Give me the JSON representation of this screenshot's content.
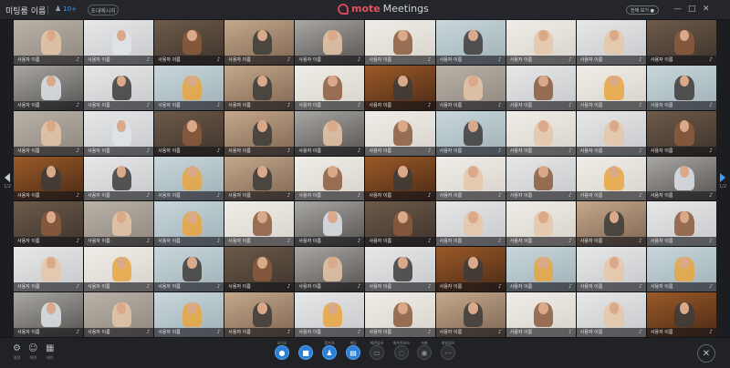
{
  "window": {
    "meeting_name": "미팅룸 이름",
    "participants_icon": "people-icon",
    "participant_count": "10+",
    "invite_label": "초대메시지",
    "logo_mote": "mote",
    "logo_meetings": "Meetings",
    "all_view_label": "전체 보기 ●",
    "minimize": "—",
    "maximize": "□",
    "close": "✕"
  },
  "grid": {
    "tile_name": "사용자 이름",
    "mic_icon": "mic-icon",
    "tiles": [
      {
        "bg": "bg-1",
        "p": "p-a"
      },
      {
        "bg": "bg-2",
        "p": "p-e"
      },
      {
        "bg": "bg-3",
        "p": "p-d"
      },
      {
        "bg": "bg-4",
        "p": "p-b"
      },
      {
        "bg": "bg-5",
        "p": "p-a"
      },
      {
        "bg": "bg-8",
        "p": "p-d"
      },
      {
        "bg": "bg-6",
        "p": "p-b"
      },
      {
        "bg": "bg-8",
        "p": "p-a"
      },
      {
        "bg": "bg-2",
        "p": "p-a"
      },
      {
        "bg": "bg-3",
        "p": "p-d"
      },
      {
        "bg": "bg-5",
        "p": "p-e"
      },
      {
        "bg": "bg-2",
        "p": "p-b"
      },
      {
        "bg": "bg-6",
        "p": "p-c"
      },
      {
        "bg": "bg-4",
        "p": "p-b"
      },
      {
        "bg": "bg-8",
        "p": "p-d"
      },
      {
        "bg": "bg-7",
        "p": "p-b"
      },
      {
        "bg": "bg-1",
        "p": "p-a"
      },
      {
        "bg": "bg-2",
        "p": "p-d"
      },
      {
        "bg": "bg-8",
        "p": "p-c"
      },
      {
        "bg": "bg-6",
        "p": "p-b"
      },
      {
        "bg": "bg-1",
        "p": "p-a"
      },
      {
        "bg": "bg-2",
        "p": "p-e"
      },
      {
        "bg": "bg-3",
        "p": "p-d"
      },
      {
        "bg": "bg-4",
        "p": "p-b"
      },
      {
        "bg": "bg-5",
        "p": "p-a"
      },
      {
        "bg": "bg-8",
        "p": "p-d"
      },
      {
        "bg": "bg-6",
        "p": "p-b"
      },
      {
        "bg": "bg-8",
        "p": "p-a"
      },
      {
        "bg": "bg-2",
        "p": "p-a"
      },
      {
        "bg": "bg-3",
        "p": "p-d"
      },
      {
        "bg": "bg-7",
        "p": "p-b"
      },
      {
        "bg": "bg-2",
        "p": "p-b"
      },
      {
        "bg": "bg-6",
        "p": "p-c"
      },
      {
        "bg": "bg-4",
        "p": "p-b"
      },
      {
        "bg": "bg-8",
        "p": "p-d"
      },
      {
        "bg": "bg-7",
        "p": "p-b"
      },
      {
        "bg": "bg-8",
        "p": "p-a"
      },
      {
        "bg": "bg-2",
        "p": "p-d"
      },
      {
        "bg": "bg-8",
        "p": "p-c"
      },
      {
        "bg": "bg-5",
        "p": "p-e"
      },
      {
        "bg": "bg-3",
        "p": "p-d"
      },
      {
        "bg": "bg-1",
        "p": "p-a"
      },
      {
        "bg": "bg-6",
        "p": "p-c"
      },
      {
        "bg": "bg-8",
        "p": "p-d"
      },
      {
        "bg": "bg-5",
        "p": "p-e"
      },
      {
        "bg": "bg-3",
        "p": "p-d"
      },
      {
        "bg": "bg-2",
        "p": "p-a"
      },
      {
        "bg": "bg-8",
        "p": "p-a"
      },
      {
        "bg": "bg-4",
        "p": "p-b"
      },
      {
        "bg": "bg-2",
        "p": "p-d"
      },
      {
        "bg": "bg-2",
        "p": "p-a"
      },
      {
        "bg": "bg-8",
        "p": "p-c"
      },
      {
        "bg": "bg-6",
        "p": "p-b"
      },
      {
        "bg": "bg-3",
        "p": "p-d"
      },
      {
        "bg": "bg-5",
        "p": "p-a"
      },
      {
        "bg": "bg-2",
        "p": "p-b"
      },
      {
        "bg": "bg-7",
        "p": "p-b"
      },
      {
        "bg": "bg-6",
        "p": "p-c"
      },
      {
        "bg": "bg-2",
        "p": "p-a"
      },
      {
        "bg": "bg-6",
        "p": "p-c"
      },
      {
        "bg": "bg-5",
        "p": "p-e"
      },
      {
        "bg": "bg-1",
        "p": "p-a"
      },
      {
        "bg": "bg-6",
        "p": "p-c"
      },
      {
        "bg": "bg-4",
        "p": "p-b"
      },
      {
        "bg": "bg-2",
        "p": "p-c"
      },
      {
        "bg": "bg-8",
        "p": "p-d"
      },
      {
        "bg": "bg-4",
        "p": "p-b"
      },
      {
        "bg": "bg-8",
        "p": "p-d"
      },
      {
        "bg": "bg-2",
        "p": "p-a"
      },
      {
        "bg": "bg-7",
        "p": "p-b",
        "active": true
      }
    ]
  },
  "pager": {
    "prev_page": "1/2",
    "next_page": "1/2"
  },
  "toolbar": {
    "left": [
      {
        "icon": "gear-icon",
        "glyph": "⚙",
        "label": "설정"
      },
      {
        "icon": "person-icon",
        "glyph": "☺",
        "label": "화면"
      },
      {
        "icon": "grid-icon",
        "glyph": "▦",
        "label": "레이"
      }
    ],
    "center": [
      {
        "icon": "mic-icon",
        "glyph": "●",
        "cap": "오디오",
        "style": "blue"
      },
      {
        "icon": "camera-icon",
        "glyph": "■",
        "cap": "",
        "style": "blue"
      },
      {
        "icon": "participants-icon",
        "glyph": "♟",
        "cap": "참가자",
        "style": "blue"
      },
      {
        "icon": "chat-icon",
        "glyph": "▤",
        "cap": "채팅",
        "style": "blue"
      },
      {
        "icon": "screen-share-icon",
        "glyph": "▭",
        "cap": "화면공유",
        "style": "dark"
      },
      {
        "icon": "whiteboard-icon",
        "glyph": "◌",
        "cap": "화이트보드",
        "style": "dark"
      },
      {
        "icon": "record-icon",
        "glyph": "◉",
        "cap": "녹화",
        "style": "dark"
      },
      {
        "icon": "more-icon",
        "glyph": "⋯",
        "cap": "파일공유",
        "style": "dark"
      }
    ],
    "exit_glyph": "✕"
  },
  "colors": {
    "accent_blue": "#2b7fd8",
    "brand_red": "#e0545f",
    "active_tile": "#e5a23a"
  }
}
